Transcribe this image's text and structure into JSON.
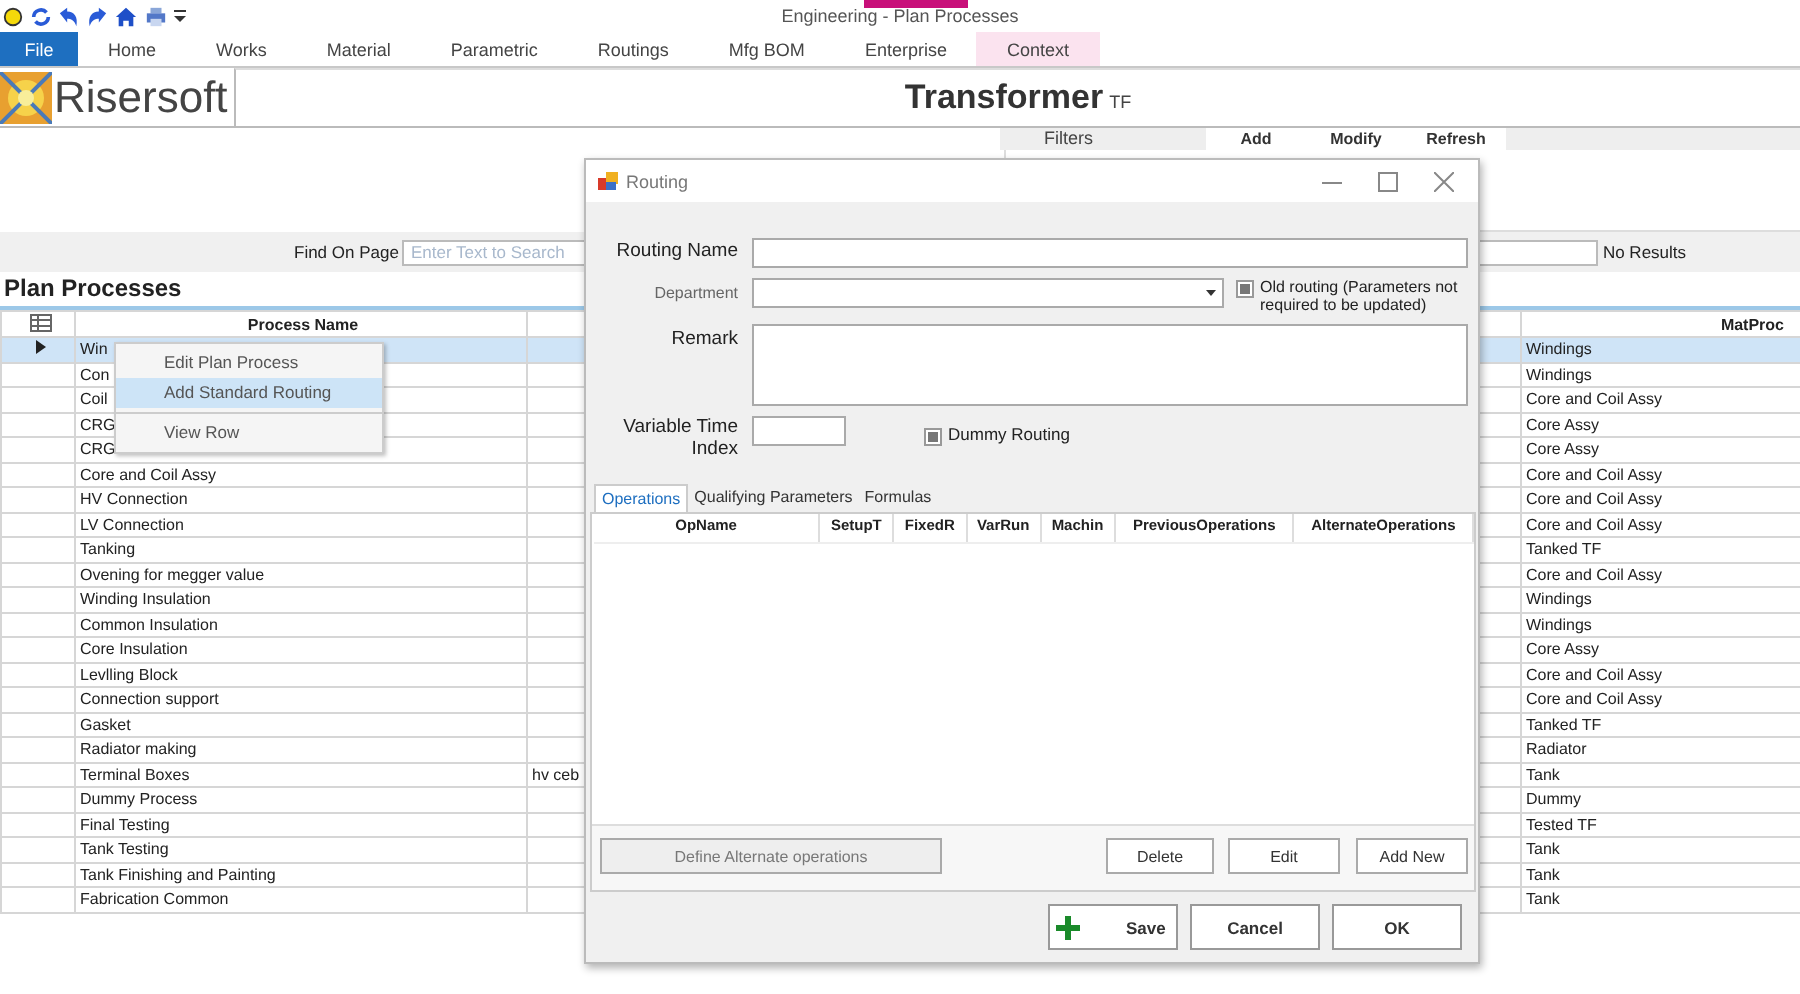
{
  "title_bar": {
    "title": "Engineering - Plan Processes"
  },
  "ribbon_tabs": [
    {
      "label": "File",
      "kind": "file",
      "selected": false
    },
    {
      "label": "Home",
      "kind": "tab",
      "selected": false
    },
    {
      "label": "Works",
      "kind": "tab",
      "selected": false
    },
    {
      "label": "Material",
      "kind": "tab",
      "selected": false
    },
    {
      "label": "Parametric",
      "kind": "tab",
      "selected": false
    },
    {
      "label": "Routings",
      "kind": "tab",
      "selected": false
    },
    {
      "label": "Mfg BOM",
      "kind": "tab",
      "selected": false
    },
    {
      "label": "Enterprise",
      "kind": "tab",
      "selected": false
    },
    {
      "label": "Context",
      "kind": "tab",
      "selected": true
    }
  ],
  "brand": {
    "name": "Risersoft"
  },
  "entity": {
    "title": "Transformer",
    "code": "TF"
  },
  "filters_bar": {
    "label": "Filters",
    "actions": [
      "Add",
      "Modify",
      "Refresh"
    ]
  },
  "find": {
    "label": "Find On Page",
    "placeholder": "Enter Text to Search",
    "result": "No Results"
  },
  "grid": {
    "title": "Plan Processes",
    "columns": {
      "process": "Process Name",
      "matproc": "MatProc"
    },
    "rows": [
      {
        "process": "Win",
        "matproc": "Windings",
        "selected": true
      },
      {
        "process": "Con",
        "matproc": "Windings",
        "selected": false
      },
      {
        "process": "Coil",
        "matproc": "Core and Coil Assy",
        "selected": false
      },
      {
        "process": "CRG",
        "matproc": "Core Assy",
        "selected": false
      },
      {
        "process": "CRG",
        "matproc": "Core Assy",
        "selected": false
      },
      {
        "process": "Core and Coil Assy",
        "matproc": "Core and Coil Assy",
        "selected": false
      },
      {
        "process": "HV Connection",
        "matproc": "Core and Coil Assy",
        "selected": false
      },
      {
        "process": "LV Connection",
        "matproc": "Core and Coil Assy",
        "selected": false
      },
      {
        "process": "Tanking",
        "matproc": "Tanked TF",
        "selected": false
      },
      {
        "process": "Ovening for megger value",
        "matproc": "Core and Coil Assy",
        "selected": false
      },
      {
        "process": "Winding Insulation",
        "matproc": "Windings",
        "selected": false
      },
      {
        "process": "Common Insulation",
        "matproc": "Windings",
        "selected": false
      },
      {
        "process": "Core Insulation",
        "matproc": "Core Assy",
        "selected": false
      },
      {
        "process": "Levlling Block",
        "matproc": "Core and Coil Assy",
        "selected": false
      },
      {
        "process": "Connection support",
        "matproc": "Core and Coil Assy",
        "selected": false
      },
      {
        "process": "Gasket",
        "matproc": "Tanked TF",
        "selected": false
      },
      {
        "process": "Radiator making",
        "matproc": "Radiator",
        "selected": false
      },
      {
        "process": "Terminal Boxes",
        "column_3": "hv ceb",
        "matproc": "Tank",
        "selected": false
      },
      {
        "process": "Dummy Process",
        "matproc": "Dummy",
        "selected": false
      },
      {
        "process": "Final Testing",
        "matproc": "Tested TF",
        "selected": false
      },
      {
        "process": "Tank Testing",
        "matproc": "Tank",
        "selected": false
      },
      {
        "process": "Tank Finishing and Painting",
        "matproc": "Tank",
        "selected": false
      },
      {
        "process": "Fabrication Common",
        "matproc": "Tank",
        "selected": false
      }
    ]
  },
  "context_menu": {
    "items": [
      {
        "label": "Edit Plan Process",
        "selected": false,
        "separator_before": false
      },
      {
        "label": "Add Standard Routing",
        "selected": true,
        "separator_before": false
      },
      {
        "label": "View Row",
        "selected": false,
        "separator_before": true
      }
    ]
  },
  "dialog": {
    "title": "Routing",
    "routing_name": {
      "label": "Routing Name"
    },
    "department": {
      "label": "Department"
    },
    "old_routing": {
      "label": "Old routing (Parameters not required to be updated)",
      "checked": false
    },
    "remark": {
      "label": "Remark"
    },
    "variable_time_index": {
      "label": "Variable Time Index"
    },
    "dummy_routing": {
      "label": "Dummy Routing",
      "checked": false
    },
    "tabs": [
      {
        "label": "Operations",
        "selected": true
      },
      {
        "label": "Qualifying Parameters",
        "selected": false
      },
      {
        "label": "Formulas",
        "selected": false
      }
    ],
    "operations_columns": [
      "OpName",
      "SetupT",
      "FixedR",
      "VarRun",
      "Machin",
      "PreviousOperations",
      "AlternateOperations"
    ],
    "panel_buttons": [
      {
        "label": "Define Alternate operations",
        "disabled": true
      },
      {
        "label": "Delete",
        "disabled": false
      },
      {
        "label": "Edit",
        "disabled": false
      },
      {
        "label": "Add New",
        "disabled": false
      }
    ],
    "footer_buttons": [
      {
        "label": "Save",
        "kind": "save"
      },
      {
        "label": "Cancel",
        "kind": "plain"
      },
      {
        "label": "OK",
        "kind": "plain"
      }
    ]
  }
}
